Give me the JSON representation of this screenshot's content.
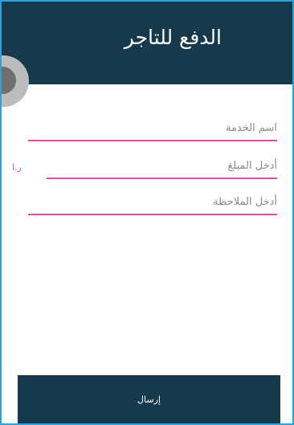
{
  "header": {
    "title": "الدفع للتاجر"
  },
  "form": {
    "service_name_label": "اسم الخدمة",
    "amount_label": "أدخل المبلغ",
    "amount_currency": "ر.ا",
    "note_label": "أدخل الملاحظة"
  },
  "submit": {
    "label": "إرسال"
  },
  "colors": {
    "header_bg": "#163a4b",
    "accent": "#e04ba8",
    "frame_border": "#29a3e0"
  }
}
